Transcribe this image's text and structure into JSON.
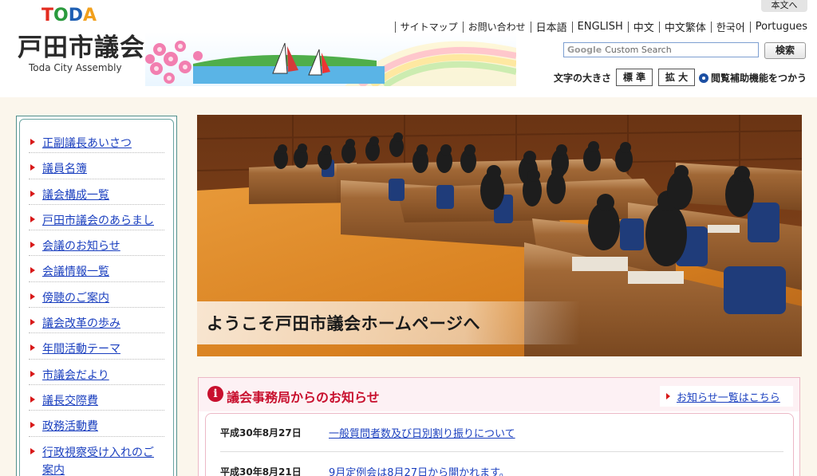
{
  "header": {
    "skip_link": "本文へ",
    "logo_mark": [
      "T",
      "O",
      "D",
      "A"
    ],
    "logo_mark_colors": [
      "#e32b1f",
      "#2a9a3d",
      "#1e5fb3",
      "#f2a01d"
    ],
    "site_title": "戸田市議会",
    "site_subtitle": "Toda City Assembly",
    "nav": [
      "サイトマップ",
      "お問い合わせ",
      "日本語",
      "ENGLISH",
      "中文",
      "中文繁体",
      "한국어",
      "Portugues"
    ],
    "search": {
      "placeholder": "Custom Search",
      "brand": "Google",
      "button": "検索"
    },
    "font_size": {
      "label": "文字の大きさ",
      "standard": "標 準",
      "large": "拡 大"
    },
    "accessibility": "閲覧補助機能をつかう"
  },
  "sidebar": {
    "items": [
      "正副議長あいさつ",
      "議員名簿",
      "議会構成一覧",
      "戸田市議会のあらまし",
      "会議のお知らせ",
      "会議情報一覧",
      "傍聴のご案内",
      "議会改革の歩み",
      "年間活動テーマ",
      "市議会だより",
      "議長交際費",
      "政務活動費",
      "行政視察受け入れのご案内"
    ]
  },
  "hero": {
    "caption": "ようこそ戸田市議会ホームページへ"
  },
  "news": {
    "title": "議会事務局からのお知らせ",
    "icon": "info-icon",
    "more_link": "お知らせ一覧はこちら",
    "items": [
      {
        "date": "平成30年8月27日",
        "text": "一般質問者数及び日別割り振りについて"
      },
      {
        "date": "平成30年8月21日",
        "text": "9月定例会は8月27日から開かれます。"
      }
    ]
  },
  "colors": {
    "accent_red": "#c8102e",
    "link_blue": "#1a3fbf",
    "sidebar_border": "#4f8f8c"
  }
}
